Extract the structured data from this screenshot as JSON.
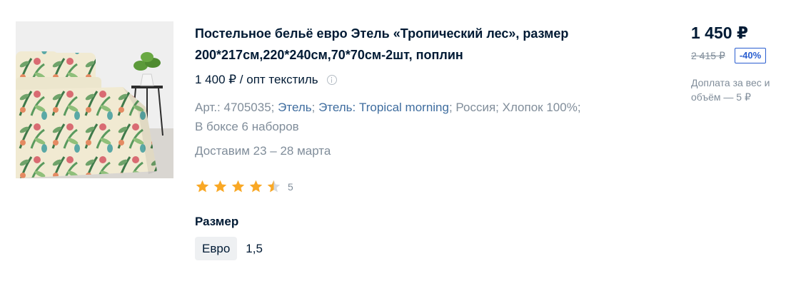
{
  "product": {
    "image_alt": "bedding-photo",
    "title": "Постельное бельё евро Этель «Тропический лес», размер 200*217см,220*240см,70*70см-2шт, поплин",
    "wholesale_price": "1 400 ₽ / опт текстиль",
    "attributes": {
      "article": "Арт.: 4705035; ",
      "brand": "Этель",
      "sep1": "; ",
      "collection": "Этель: Tropical morning",
      "rest": "; Россия; Хлопок 100%;",
      "box": "В боксе 6 наборов"
    },
    "delivery": "Доставим 23 – 28 марта",
    "rating": {
      "stars": 4.5,
      "count": "5"
    },
    "size": {
      "label": "Размер",
      "options": [
        "Евро",
        "1,5"
      ],
      "selected": "Евро"
    }
  },
  "pricing": {
    "price": "1 450 ₽",
    "old_price": "2 415 ₽",
    "discount": "-40%",
    "surcharge": "Доплата за вес и объём — 5 ₽"
  },
  "colors": {
    "star": "#f9a825",
    "link": "#3f6d9f",
    "discount": "#2a5ed0",
    "muted": "#808d9a"
  }
}
